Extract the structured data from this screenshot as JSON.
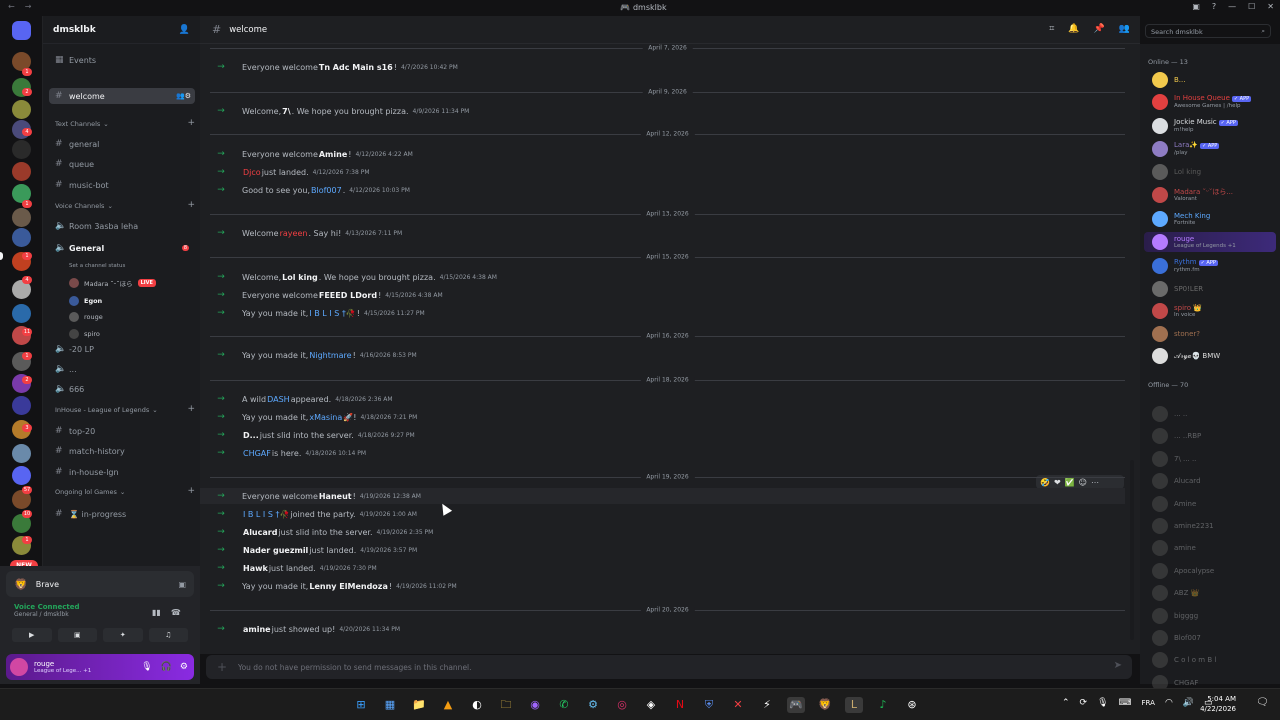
{
  "window": {
    "title": "dmsklbk"
  },
  "server": {
    "name": "dmsklbk"
  },
  "sidebar": {
    "events": "Events",
    "active_channel": "welcome",
    "categories": [
      {
        "label": "Text Channels",
        "channels": [
          "general",
          "queue",
          "music-bot"
        ]
      },
      {
        "label": "Voice Channels",
        "channels": [
          "Room 3asba leha",
          "General",
          "-20 LP",
          "...",
          "666"
        ]
      },
      {
        "label": "InHouse - League of Legends",
        "channels": [
          "top-20",
          "match-history",
          "in-house-lgn"
        ]
      },
      {
        "label": "Ongoing lol Games",
        "channels": [
          "⌛ in-progress"
        ]
      }
    ],
    "general_status": "Set a channel status",
    "general_badge": "8",
    "voice_users": [
      {
        "name": "Madara ˘ᵕ˘ほら",
        "live": "LIVE"
      },
      {
        "name": "Egon"
      },
      {
        "name": "rouge"
      },
      {
        "name": "spiro"
      }
    ]
  },
  "activity": {
    "app": "Brave"
  },
  "voice": {
    "status": "Voice Connected",
    "channel": "General / dmsklbk"
  },
  "user": {
    "name": "rouge",
    "status": "League of Lege... +1"
  },
  "channel": {
    "name": "welcome",
    "input_placeholder": "You do not have permission to send messages in this channel."
  },
  "search": {
    "placeholder": "Search dmsklbk"
  },
  "guild_badges": [
    "1",
    "2",
    "4",
    "1",
    "1",
    "4",
    "11",
    "1",
    "2",
    "3",
    "57",
    "10",
    "1"
  ],
  "guild_new": "NEW",
  "messages": [
    {
      "type": "divider",
      "date": "April 7, 2026"
    },
    {
      "type": "msg",
      "pre": "Everyone welcome ",
      "user": "Tn Adc Main s16",
      "post": "!",
      "ts": "4/7/2026 10:42 PM"
    },
    {
      "type": "divider",
      "date": "April 9, 2026"
    },
    {
      "type": "msg",
      "pre": "Welcome, ",
      "user": "7\\",
      "post": ". We hope you brought pizza.",
      "ts": "4/9/2026 11:34 PM"
    },
    {
      "type": "divider",
      "date": "April 12, 2026"
    },
    {
      "type": "msg",
      "pre": "Everyone welcome ",
      "user": "Amine",
      "post": "!",
      "ts": "4/12/2026 4:22 AM"
    },
    {
      "type": "msg",
      "pre": "",
      "user": "Djco",
      "post": " just landed.",
      "ts": "4/12/2026 7:38 PM",
      "color": "#f23f43"
    },
    {
      "type": "msg",
      "pre": "Good to see you, ",
      "user": "Blof007",
      "post": ".",
      "ts": "4/12/2026 10:03 PM",
      "color": "#5da9ff"
    },
    {
      "type": "divider",
      "date": "April 13, 2026"
    },
    {
      "type": "msg",
      "pre": "Welcome ",
      "user": "rayeen",
      "post": ". Say hi!",
      "ts": "4/13/2026 7:11 PM",
      "color": "#f23f43"
    },
    {
      "type": "divider",
      "date": "April 15, 2026"
    },
    {
      "type": "msg",
      "pre": "Welcome, ",
      "user": "Lol king",
      "post": ". We hope you brought pizza.",
      "ts": "4/15/2026 4:38 AM"
    },
    {
      "type": "msg",
      "pre": "Everyone welcome ",
      "user": "FEEED LDord",
      "post": "!",
      "ts": "4/15/2026 4:38 AM"
    },
    {
      "type": "msg",
      "pre": "Yay you made it, ",
      "user": "I B L I S †🥀",
      "post": "!",
      "ts": "4/15/2026 11:27 PM",
      "color": "#5da9ff"
    },
    {
      "type": "divider",
      "date": "April 16, 2026"
    },
    {
      "type": "msg",
      "pre": "Yay you made it, ",
      "user": "Nightmare",
      "post": "!",
      "ts": "4/16/2026 8:53 PM",
      "color": "#5da9ff"
    },
    {
      "type": "divider",
      "date": "April 18, 2026"
    },
    {
      "type": "msg",
      "pre": "A wild ",
      "user": "DASH",
      "post": " appeared.",
      "ts": "4/18/2026 2:36 AM",
      "color": "#5da9ff"
    },
    {
      "type": "msg",
      "pre": "Yay you made it, ",
      "user": "xMasina",
      "post": " 🚀!",
      "ts": "4/18/2026 7:21 PM",
      "color": "#5da9ff"
    },
    {
      "type": "msg",
      "pre": "",
      "user": "D...",
      "post": " just slid into the server.",
      "ts": "4/18/2026 9:27 PM"
    },
    {
      "type": "msg",
      "pre": "",
      "user": "CHGAF",
      "post": " is here.",
      "ts": "4/18/2026 10:14 PM",
      "color": "#5da9ff"
    },
    {
      "type": "divider",
      "date": "April 19, 2026"
    },
    {
      "type": "msg",
      "pre": "Everyone welcome ",
      "user": "Haneut",
      "post": "!",
      "ts": "4/19/2026 12:38 AM",
      "hl": true
    },
    {
      "type": "msg",
      "pre": "",
      "user": "I B L I S †🥀",
      "post": " joined the party.",
      "ts": "4/19/2026 1:00 AM",
      "color": "#5da9ff"
    },
    {
      "type": "msg",
      "pre": "",
      "user": "Alucard",
      "post": " just slid into the server.",
      "ts": "4/19/2026 2:35 PM"
    },
    {
      "type": "msg",
      "pre": "",
      "user": "Nader guezmil",
      "post": " just landed.",
      "ts": "4/19/2026 3:57 PM"
    },
    {
      "type": "msg",
      "pre": "",
      "user": "Hawk",
      "post": " just landed.",
      "ts": "4/19/2026 7:30 PM"
    },
    {
      "type": "msg",
      "pre": "Yay you made it, ",
      "user": "Lenny ElMendoza",
      "post": "!",
      "ts": "4/19/2026 11:02 PM"
    },
    {
      "type": "divider",
      "date": "April 20, 2026"
    },
    {
      "type": "msg",
      "pre": "",
      "user": "amine",
      "post": " just showed up!",
      "ts": "4/20/2026 11:34 PM"
    }
  ],
  "members": {
    "online_header": "Online — 13",
    "offline_header": "Offline — 70",
    "online": [
      {
        "name": "B...",
        "status": "",
        "color": "#f2c94c"
      },
      {
        "name": "In House Queue",
        "tag": "✓ APP",
        "status": "Awesome Games | /help",
        "color": "#e24040"
      },
      {
        "name": "Jockie Music",
        "tag": "✓ APP",
        "status": "m!help",
        "color": "#dbdee1"
      },
      {
        "name": "Lara✨",
        "tag": "✓ APP",
        "status": "/play",
        "color": "#8e7cc3"
      },
      {
        "name": "Lol king",
        "status": "",
        "color": "#5a5a5a"
      },
      {
        "name": "Madara ˘ᵕ˘ほら...",
        "status": "Valorant",
        "color": "#c04848"
      },
      {
        "name": "Mech King",
        "status": "Fortnite",
        "color": "#5da9ff"
      },
      {
        "name": "rouge",
        "status": "League of Legends +1",
        "color": "#b57bff"
      },
      {
        "name": "Rythm",
        "tag": "✓ APP",
        "status": "rythm.fm",
        "color": "#3a6fd8"
      },
      {
        "name": "SP0!LER",
        "status": "",
        "color": "#6a6a6a"
      },
      {
        "name": "spiro 👑",
        "status": "In voice",
        "color": "#c04848"
      },
      {
        "name": "stoner?",
        "status": "",
        "color": "#a07050"
      },
      {
        "name": "𝒜𝓇𝓎𝒶💀 BMW",
        "status": "",
        "color": "#ddd"
      }
    ],
    "offline": [
      "... ..",
      "... ..RBP",
      "7\\ ... ..",
      "Alucard",
      "Amine",
      "amine2231",
      "amine",
      "Apocalypse",
      "ABZ 👑",
      "bigggg",
      "Blof007",
      "C o l o m B l",
      "CHGAF"
    ]
  },
  "taskbar": {
    "lang": "FRA",
    "time": "5:04 AM",
    "date": "4/22/2026"
  }
}
